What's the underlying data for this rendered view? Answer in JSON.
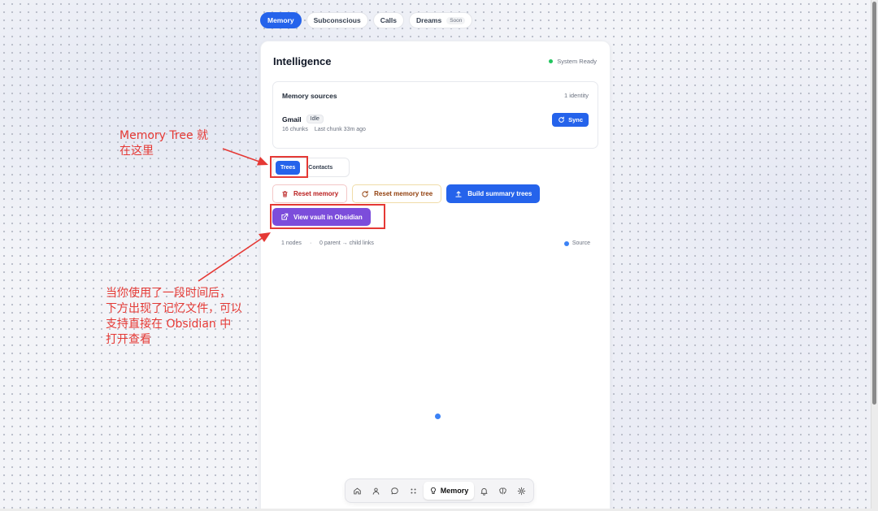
{
  "top_tabs": [
    {
      "label": "Memory",
      "active": true
    },
    {
      "label": "Subconscious",
      "active": false
    },
    {
      "label": "Calls",
      "active": false
    },
    {
      "label": "Dreams",
      "badge": "Soon",
      "active": false
    }
  ],
  "card": {
    "title": "Intelligence",
    "status": "System Ready",
    "status_color": "#22c55e"
  },
  "sources": {
    "heading": "Memory sources",
    "count": "1 identity",
    "item": {
      "name": "Gmail",
      "state": "Idle",
      "chunks": "16 chunks",
      "last_chunk": "Last chunk 33m ago",
      "sync_label": "Sync"
    }
  },
  "subtabs": [
    {
      "label": "Trees",
      "active": true
    },
    {
      "label": "Contacts",
      "active": false
    }
  ],
  "actions": {
    "reset_memory": "Reset memory",
    "reset_tree": "Reset memory tree",
    "build_trees": "Build summary trees",
    "view_vault": "View vault in Obsidian"
  },
  "graph": {
    "nodes": "1 nodes",
    "separator": "·",
    "links": "0 parent → child links",
    "legend": "Source",
    "node_color": "#3b82f6"
  },
  "dock": {
    "items": [
      "home-icon",
      "person-icon",
      "chat-icon",
      "apps-icon",
      "bulb-icon",
      "bell-icon",
      "brain-icon",
      "gear-icon"
    ],
    "active_label": "Memory"
  },
  "annotations": {
    "memory_tree": "Memory Tree 就\n在这里",
    "obsidian": "当你使用了一段时间后，\n下方出现了记忆文件，可以\n支持直接在 Obsidian 中\n打开查看",
    "color": "#e53935"
  }
}
